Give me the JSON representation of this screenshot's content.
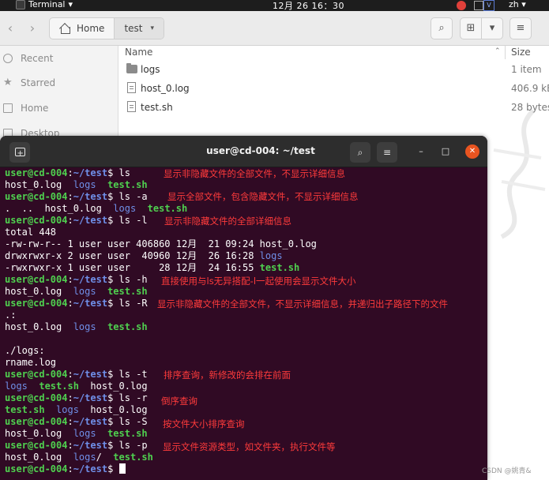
{
  "topbar": {
    "app_name": "Terminal",
    "app_chevron": "▾",
    "clock": "12月 26 16：30",
    "lang": "zh",
    "lang_chevron": "▾",
    "tray_icons": [
      "error-icon",
      "grid-icon",
      "input-method-icon"
    ]
  },
  "fm": {
    "back_glyph": "‹",
    "forward_glyph": "›",
    "breadcrumb": [
      "Home",
      "test"
    ],
    "crumb_chevron": "▾",
    "search_glyph": "⌕",
    "grid_glyph": "⊞",
    "view_chevron": "▾",
    "menu_glyph": "≡",
    "sidebar": [
      "Recent",
      "Starred",
      "Home",
      "Desktop"
    ],
    "columns": {
      "name": "Name",
      "size": "Size",
      "sort_glyph": "⌃"
    },
    "files": [
      {
        "name": "logs",
        "size": "1 item",
        "icon": "folder-icon"
      },
      {
        "name": "host_0.log",
        "size": "406.9 kB",
        "icon": "log-file-icon"
      },
      {
        "name": "test.sh",
        "size": "28 bytes",
        "icon": "script-file-icon"
      }
    ]
  },
  "terminal": {
    "title": "user@cd-004: ~/test",
    "search_glyph": "⌕",
    "menu_glyph": "≡",
    "minimize_glyph": "–",
    "maximize_glyph": "□",
    "close_glyph": "✕",
    "prompt": {
      "user": "user@cd-004",
      "colon": ":",
      "path": "~/test",
      "dollar": "$"
    },
    "commands": {
      "c1": " ls",
      "c2": " ls -a",
      "c3": " ls -l",
      "c4": " ls -h",
      "c5": " ls -R",
      "c6": " ls -t",
      "c7": " ls -r",
      "c8": " ls -S",
      "c9": " ls -p",
      "c10": " "
    },
    "notes": {
      "n1": "显示非隐藏文件的全部文件，不显示详细信息",
      "n2": "显示全部文件，包含隐藏文件，不显示详细信息",
      "n3": "显示非隐藏文件的全部详细信息",
      "n4": "直接使用与ls无异搭配-l一起使用会显示文件大小",
      "n5": "显示非隐藏文件的全部文件，不显示详细信息，并递归出子路径下的文件",
      "n6": "排序查询，新修改的会排在前面",
      "n7": "倒序查询",
      "n8": "按文件大小排序查询",
      "n9": "显示文件资源类型，如文件夹，执行文件等"
    },
    "out": {
      "o1a": "host_0.log  ",
      "o1b": "logs",
      "o1c": "  ",
      "o1d": "test.sh",
      "o2a": ".  ..  host_0.log  ",
      "o2b": "logs",
      "o2c": "  ",
      "o2d": "test.sh",
      "total": "total 448",
      "l1": "-rw-rw-r-- 1 user user 406860 12月  21 09:24 host_0.log",
      "l2a": "drwxrwxr-x 2 user user  40960 12月  26 16:28 ",
      "l2b": "logs",
      "l3a": "-rwxrwxr-x 1 user user     28 12月  24 16:55 ",
      "l3b": "test.sh",
      "o4a": "host_0.log  ",
      "o4b": "logs",
      "o4c": "  ",
      "o4d": "test.sh",
      "r_dot": ".:",
      "o5a": "host_0.log  ",
      "o5b": "logs",
      "o5c": "  ",
      "o5d": "test.sh",
      "r_logs": "./logs:",
      "r_rname": "rname.log",
      "o6a": "logs",
      "o6b": "  ",
      "o6c": "test.sh",
      "o6d": "  host_0.log",
      "o7a": "test.sh",
      "o7b": "  ",
      "o7c": "logs",
      "o7d": "  host_0.log",
      "o8a": "host_0.log  ",
      "o8b": "logs",
      "o8c": "  ",
      "o8d": "test.sh",
      "o9a": "host_0.log  ",
      "o9b": "logs",
      "o9c": "/  ",
      "o9d": "test.sh"
    }
  },
  "credit": "CSDN @姚青&"
}
